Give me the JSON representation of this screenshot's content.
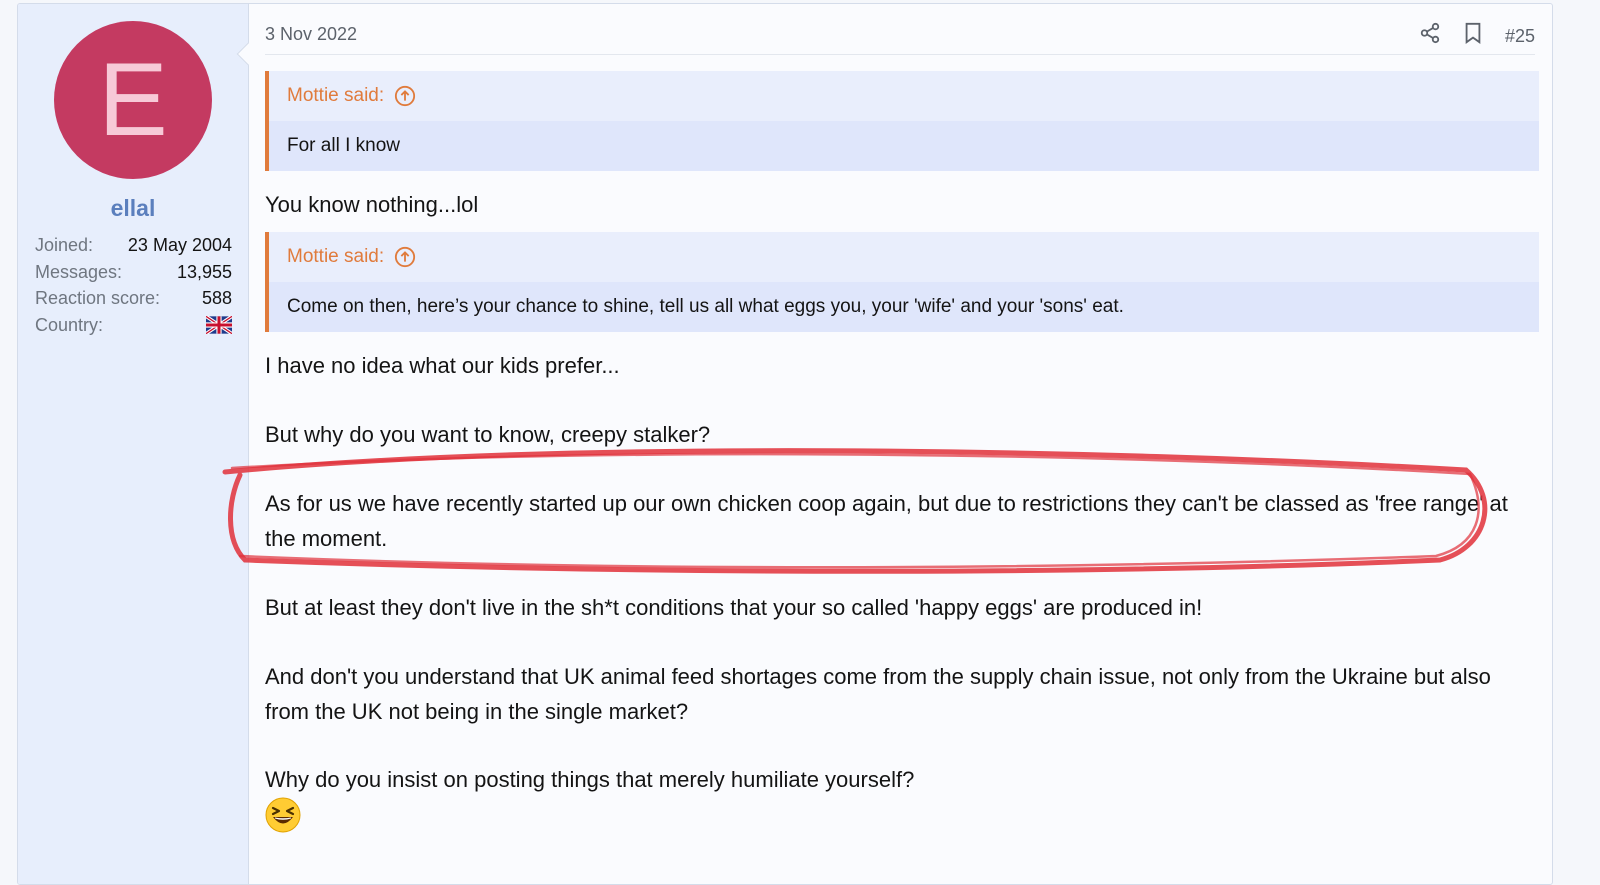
{
  "user": {
    "avatar_letter": "E",
    "avatar_color": "#c43a61",
    "username": "ellal",
    "stats": [
      {
        "label": "Joined:",
        "value": "23 May 2004"
      },
      {
        "label": "Messages:",
        "value": "13,955"
      },
      {
        "label": "Reaction score:",
        "value": "588"
      },
      {
        "label": "Country:",
        "value": "uk-flag-icon"
      }
    ]
  },
  "post": {
    "date": "3 Nov 2022",
    "number": "#25",
    "quotes": [
      {
        "author": "Mottie said:",
        "text": "For all I know"
      },
      {
        "author": "Mottie said:",
        "text": "Come on then, here’s your chance to shine, tell us all what eggs you, your 'wife' and your 'sons' eat."
      }
    ],
    "reply_1": "You know nothing...lol",
    "paragraphs": [
      "I have no idea what our kids prefer...",
      "But why do you want to know, creepy stalker?",
      "As for us we have recently started up our own chicken coop again, but due to restrictions they can't be classed as 'free range' at the moment.",
      "But at least they don't live in the sh*t conditions that your so called 'happy eggs' are produced in!",
      "And don't you understand that UK animal feed shortages come from the supply chain issue, not only from the Ukraine but also from the UK not being in the single market?",
      "Why do you insist on posting things that merely humiliate yourself?"
    ],
    "emoji": "laughing-squinting-emoji"
  },
  "colors": {
    "accent": "#e07b3c",
    "username": "#5b7fbd",
    "annotation": "#e0303a"
  }
}
